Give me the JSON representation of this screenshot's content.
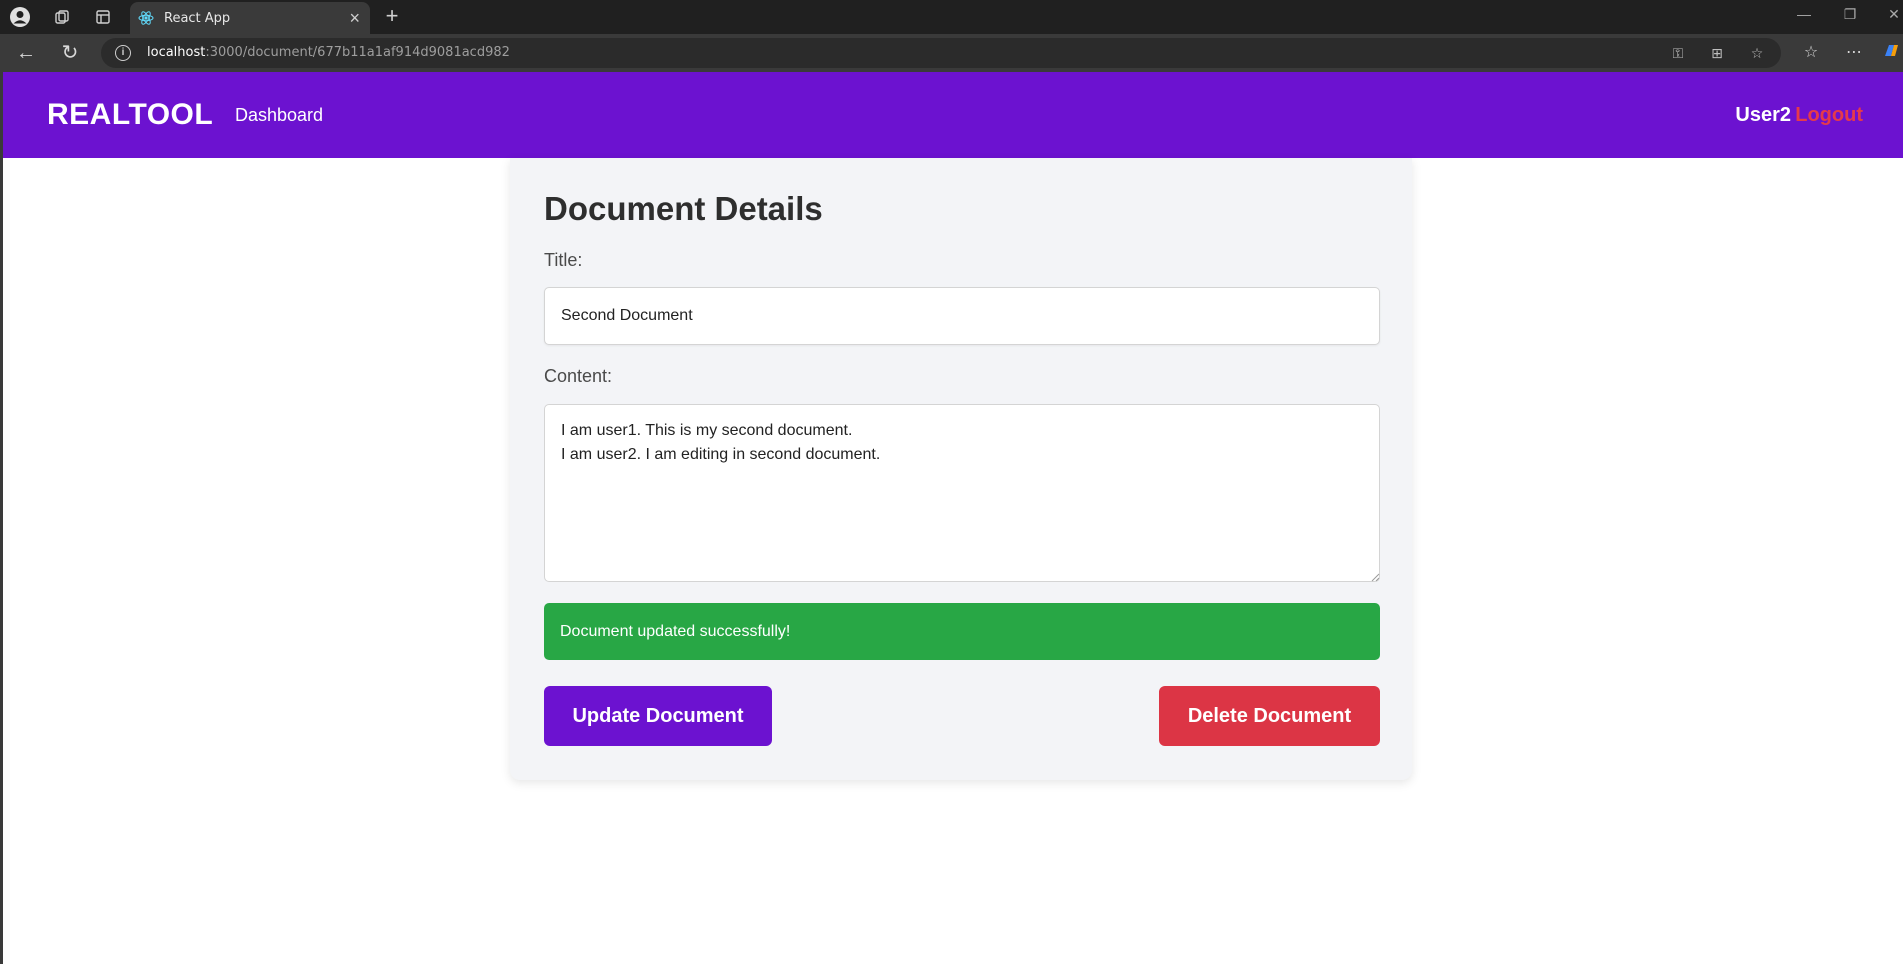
{
  "browser": {
    "tab_title": "React App",
    "url_host": "localhost",
    "url_rest": ":3000/document/677b11a1af914d9081acd982"
  },
  "navbar": {
    "brand": "REALTOOL",
    "dashboard_link": "Dashboard",
    "username": "User2",
    "logout_link": "Logout"
  },
  "document": {
    "heading": "Document Details",
    "title_label": "Title:",
    "title_value": "Second Document",
    "content_label": "Content:",
    "content_value": "I am user1. This is my second document.\nI am user2. I am editing in second document.",
    "status_message": "Document updated successfully!",
    "update_button": "Update Document",
    "delete_button": "Delete Document"
  },
  "colors": {
    "brand_purple": "#6c12d0",
    "logout_red": "#e53a4a",
    "success_green": "#28a745",
    "danger_red": "#dc3545"
  }
}
